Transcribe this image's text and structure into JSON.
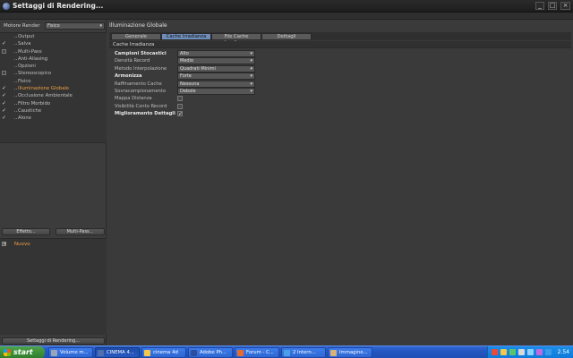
{
  "window": {
    "title": "Settaggi di Rendering...",
    "minimize": "_",
    "maximize": "□",
    "close": "×"
  },
  "left": {
    "engine_label": "Motore Render",
    "engine_value": "Fisico",
    "dropdown_arrow": "▾",
    "tree": [
      {
        "label": "Output",
        "checkbox": "none",
        "selected": false
      },
      {
        "label": "Salva",
        "checkbox": "checked",
        "selected": false
      },
      {
        "label": "Multi-Pass",
        "checkbox": "box",
        "selected": false
      },
      {
        "label": "Anti-Aliasing",
        "checkbox": "none",
        "selected": false
      },
      {
        "label": "Opzioni",
        "checkbox": "none",
        "selected": false
      },
      {
        "label": "Stereoscopico",
        "checkbox": "box",
        "selected": false
      },
      {
        "label": "Fisico",
        "checkbox": "none",
        "selected": false
      },
      {
        "label": "Illuminazione Globale",
        "checkbox": "checked",
        "selected": true
      },
      {
        "label": "Occlusione Ambientale",
        "checkbox": "checked",
        "selected": false
      },
      {
        "label": "Filtro Morbido",
        "checkbox": "checked",
        "selected": false
      },
      {
        "label": "Caustiche",
        "checkbox": "checked",
        "selected": false
      },
      {
        "label": "Alone",
        "checkbox": "checked",
        "selected": false
      }
    ],
    "check_glyph": "✓",
    "effect_button": "Effetto...",
    "multipass_button": "Multi-Pass...",
    "effects": [
      {
        "label": "Nuovo",
        "check": "✕"
      }
    ],
    "settings_button": "Settaggi di Rendering..."
  },
  "right": {
    "section_title": "Illuminazione Globale",
    "tabs": [
      "Generale",
      "Cache Irradianza",
      "File Cache Irradianza",
      "Dettagli"
    ],
    "active_tab": "Cache Irradianza",
    "subheader": "Cache Irradianza",
    "params": [
      {
        "label": "Campioni Stocastici",
        "bold": true,
        "kind": "select",
        "value": "Alto"
      },
      {
        "label": "Densità Record",
        "bold": false,
        "kind": "select",
        "value": "Medio"
      },
      {
        "label": "Metodo Interpolazione",
        "bold": false,
        "kind": "select",
        "value": "Quadrati Minimi"
      },
      {
        "label": "Armonizza",
        "bold": true,
        "kind": "select",
        "value": "Forte"
      },
      {
        "label": "Raffinamento Cache",
        "bold": false,
        "kind": "select",
        "value": "Nessuna"
      },
      {
        "label": "Sovracampionamento",
        "bold": false,
        "kind": "select",
        "value": "Debole"
      },
      {
        "label": "Mappa Distanza",
        "bold": false,
        "kind": "check",
        "value": ""
      },
      {
        "label": "Visibilità Conto Record",
        "bold": false,
        "kind": "check",
        "value": ""
      },
      {
        "label": "Miglioramento Dettagli",
        "bold": true,
        "kind": "check",
        "value": "✓"
      }
    ]
  },
  "taskbar": {
    "start": "start",
    "tasks": [
      {
        "label": "Volume m...",
        "active": false,
        "icon_color": "#9aa6b8"
      },
      {
        "label": "CINEMA 4...",
        "active": true,
        "icon_color": "#4f6fae"
      },
      {
        "label": "cinema 4d",
        "active": false,
        "icon_color": "#f2c94c"
      },
      {
        "label": "Adobe Ph...",
        "active": false,
        "icon_color": "#2b4f9e"
      },
      {
        "label": "Forum - C...",
        "active": false,
        "icon_color": "#e86a2c"
      },
      {
        "label": "2 Intern...",
        "active": false,
        "icon_color": "#4aa0e6"
      },
      {
        "label": "Immagine...",
        "active": false,
        "icon_color": "#d8b27a"
      }
    ],
    "clock": "2.54"
  }
}
